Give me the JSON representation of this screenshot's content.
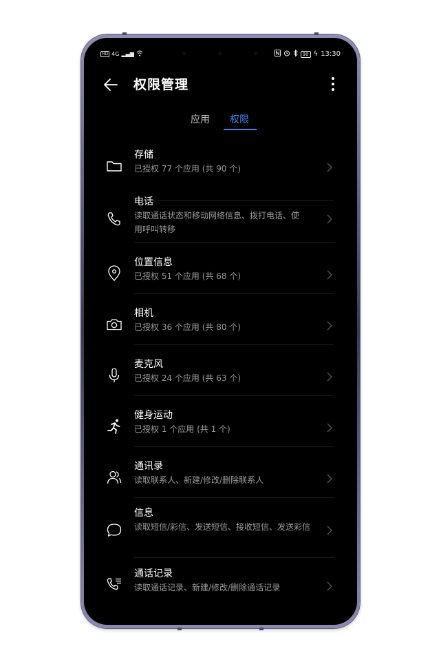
{
  "status_bar": {
    "left": "4G",
    "hd": "HD",
    "battery": "90",
    "time": "13:30"
  },
  "app_bar": {
    "title": "权限管理"
  },
  "tabs": [
    {
      "label": "应用",
      "selected": false
    },
    {
      "label": "权限",
      "selected": true
    }
  ],
  "accent_color": "#3f86f0",
  "permissions": [
    {
      "icon": "folder-icon",
      "name": "存储",
      "description": "已授权 77 个应用 (共 90 个)"
    },
    {
      "icon": "phone-icon",
      "name": "电话",
      "description": "读取通话状态和移动网络信息、拨打电话、使用呼叫转移"
    },
    {
      "icon": "location-pin-icon",
      "name": "位置信息",
      "description": "已授权 51 个应用 (共 68 个)"
    },
    {
      "icon": "camera-icon",
      "name": "相机",
      "description": "已授权 36 个应用 (共 80 个)"
    },
    {
      "icon": "microphone-icon",
      "name": "麦克风",
      "description": "已授权 24 个应用 (共 63 个)"
    },
    {
      "icon": "running-person-icon",
      "name": "健身运动",
      "description": "已授权 1 个应用 (共 1 个)"
    },
    {
      "icon": "contacts-icon",
      "name": "通讯录",
      "description": "读取联系人、新建/修改/删除联系人"
    },
    {
      "icon": "message-bubble-icon",
      "name": "信息",
      "description": "读取短信/彩信、发送短信、接收短信、发送彩信"
    },
    {
      "icon": "call-log-icon",
      "name": "通话记录",
      "description": "读取通话记录、新建/修改/删除通话记录"
    }
  ]
}
